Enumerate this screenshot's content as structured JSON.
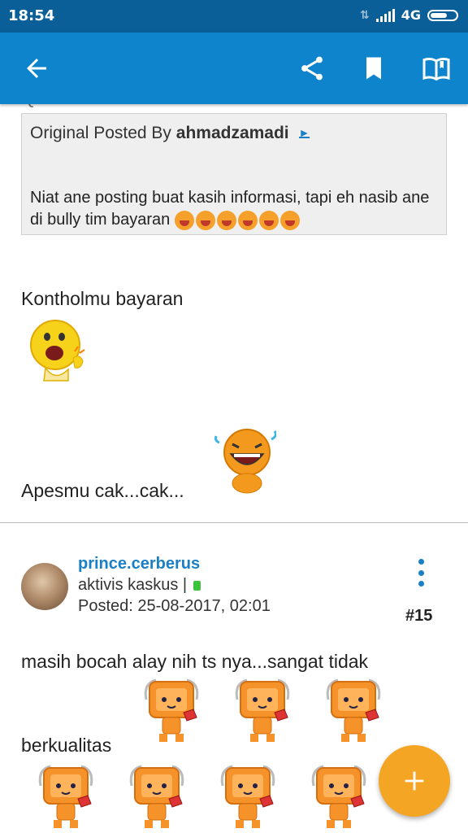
{
  "status_bar": {
    "time": "18:54",
    "network": "4G"
  },
  "app_bar": {
    "icons": [
      "back-arrow-icon",
      "share-icon",
      "bookmark-icon",
      "open-book-icon"
    ]
  },
  "quote": {
    "label": "Quote:",
    "posted_by_prefix": "Original Posted By",
    "author": "ahmadzamadi",
    "message": "Niat ane posting buat kasih informasi, tapi eh nasib ane di bully tim bayaran"
  },
  "reply_1": {
    "text1": "Kontholmu bayaran",
    "text2": "Apesmu cak...cak..."
  },
  "post": {
    "username": "prince.cerberus",
    "rank": "aktivis kaskus |",
    "posted": "Posted: 25-08-2017, 02:01",
    "number": "#15",
    "text_line1": "masih bocah alay nih ts nya...sangat tidak",
    "text_line2": "berkualitas"
  },
  "colors": {
    "statusbar": "#0a5f99",
    "appbar": "#0d84cc",
    "accent": "#1a7fc4",
    "fab": "#f5a524"
  }
}
